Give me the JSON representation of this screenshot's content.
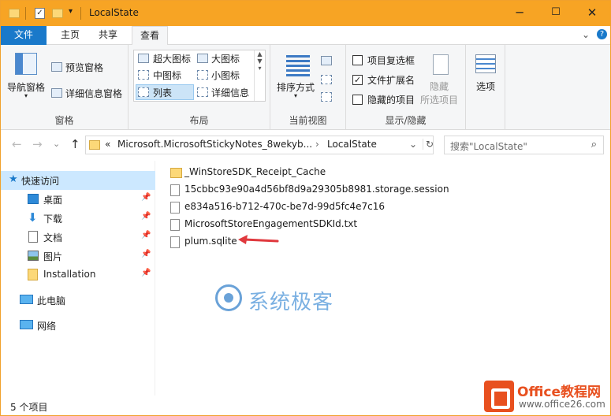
{
  "window": {
    "title": "LocalState",
    "minimize": "─",
    "maximize": "☐",
    "close": "✕"
  },
  "tabs": {
    "file": "文件",
    "home": "主页",
    "share": "共享",
    "view": "查看",
    "expand": "⌄",
    "help": "?"
  },
  "ribbon": {
    "panes": {
      "nav_pane": "导航窗格",
      "preview_pane": "预览窗格",
      "details_pane": "详细信息窗格",
      "group": "窗格"
    },
    "layout": {
      "extra_large": "超大图标",
      "large": "大图标",
      "medium": "中图标",
      "small": "小图标",
      "list": "列表",
      "details": "详细信息",
      "group": "布局"
    },
    "current_view": {
      "sort_by": "排序方式",
      "group": "当前视图"
    },
    "show_hide": {
      "item_checkboxes": "项目复选框",
      "file_extensions": "文件扩展名",
      "hidden_items": "隐藏的项目",
      "hide": "隐藏",
      "hide_selected": "所选项目",
      "group": "显示/隐藏"
    },
    "options": "选项"
  },
  "address": {
    "back": "←",
    "forward": "→",
    "recent": "⌄",
    "up": "↑",
    "prefix": "«",
    "segment1": "Microsoft.MicrosoftStickyNotes_8wekyb...",
    "separator": "›",
    "segment2": "LocalState",
    "dropdown": "⌄",
    "refresh": "↻",
    "search_placeholder": "搜索\"LocalState\"",
    "search_icon": "⌕"
  },
  "sidebar": {
    "quick_access": "快速访问",
    "items": [
      {
        "label": "桌面"
      },
      {
        "label": "下载"
      },
      {
        "label": "文档"
      },
      {
        "label": "图片"
      },
      {
        "label": "Installation"
      }
    ],
    "this_pc": "此电脑",
    "network": "网络",
    "pin": "📌"
  },
  "files": [
    {
      "name": "_WinStoreSDK_Receipt_Cache",
      "type": "folder"
    },
    {
      "name": "15cbbc93e90a4d56bf8d9a29305b8981.storage.session",
      "type": "file"
    },
    {
      "name": "e834a516-b712-470c-be7d-99d5fc4e7c16",
      "type": "file"
    },
    {
      "name": "MicrosoftStoreEngagementSDKId.txt",
      "type": "file"
    },
    {
      "name": "plum.sqlite",
      "type": "file"
    }
  ],
  "status": {
    "count": "5 个项目"
  },
  "watermark": {
    "text": "系统极客"
  },
  "brand": {
    "name": "Office教程网",
    "url": "www.office26.com"
  },
  "colors": {
    "titlebar": "#f7a424",
    "file_tab": "#1979ca",
    "selection": "#cce8ff",
    "arrow": "#e0393e",
    "brand": "#e8501f"
  }
}
